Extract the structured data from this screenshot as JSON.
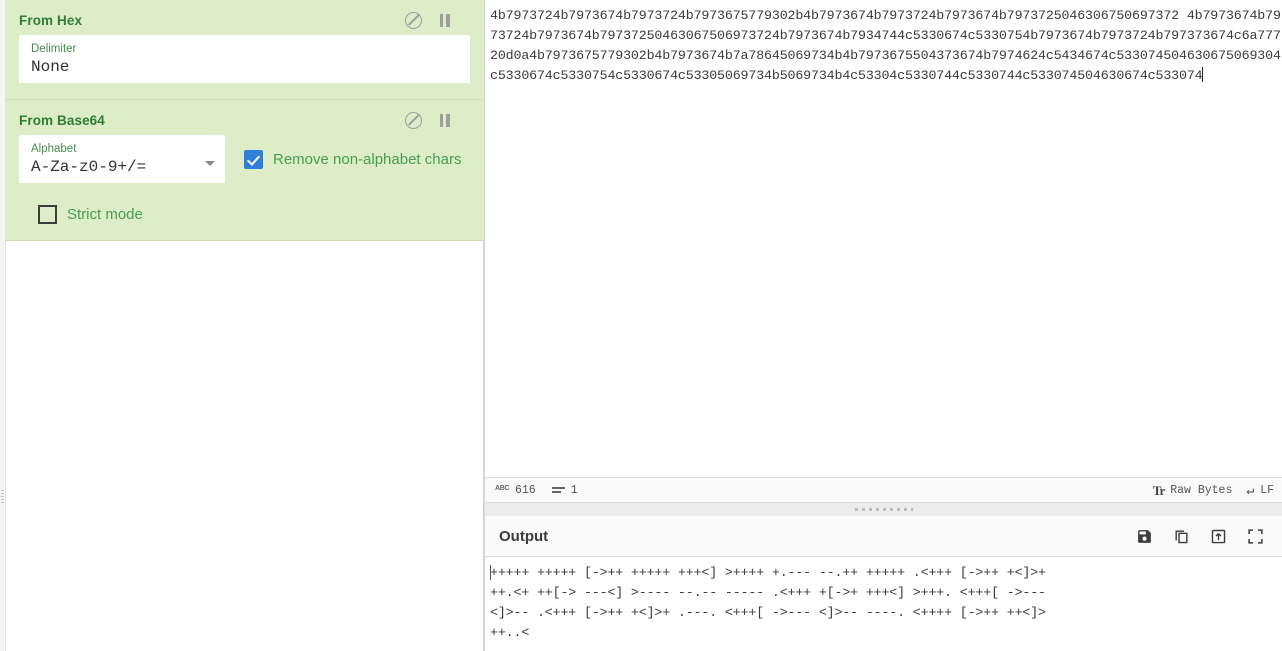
{
  "recipe": {
    "operations": [
      {
        "name": "From Hex",
        "disable_icon": "disable-circle-slash-icon",
        "pause_icon": "pause-breakpoint-icon",
        "args": [
          {
            "type": "text",
            "label": "Delimiter",
            "value": "None"
          }
        ]
      },
      {
        "name": "From Base64",
        "disable_icon": "disable-circle-slash-icon",
        "pause_icon": "pause-breakpoint-icon",
        "args": [
          {
            "type": "select",
            "label": "Alphabet",
            "value": "A-Za-z0-9+/="
          },
          {
            "type": "checkbox",
            "label": "Remove non-alphabet chars",
            "checked": true
          },
          {
            "type": "checkbox",
            "label": "Strict mode",
            "checked": false
          }
        ]
      }
    ]
  },
  "input": {
    "value": "4b7973724b7973674b7973724b7973675779302b4b7973674b7973724b7973674b7973725046306750697372 4b7973674b7973724b7973674b79737250463067506973724b7973674b7934744c5330674c5330754b7973674b7973724b797373674c6a77720d0a4b7973675779302b4b7973674b7a78645069734b4b7973675504373674b7974624c5434674c533074504630675069304c5330674c5330754c5330674c53305069734b5069734b4c53304c5330744c5330744c533074504630674c533074",
    "char_count": "616",
    "line_count": "1",
    "encoding_label": "Raw Bytes",
    "line_ending_label": "LF",
    "char_count_icon": "abc-character-count-icon",
    "line_count_icon": "lines-count-icon",
    "encoding_icon": "font-tt-icon",
    "line_ending_icon": "return-arrow-icon"
  },
  "output": {
    "title": "Output",
    "value": "+++++ +++++ [->++ +++++ +++<] >++++ +.--- --.++ +++++ .<+++ [->++ +<]>+\n++.<+ ++[-> ---<] >---- --.-- ----- .<+++ +[->+ +++<] >+++. <+++[ ->---\n<]>-- .<+++ [->++ +<]>+ .---. <+++[ ->--- <]>-- ----. <++++ [->++ ++<]>\n++..<",
    "icons": [
      {
        "name": "save-icon",
        "title": "Save output to file"
      },
      {
        "name": "copy-icon",
        "title": "Copy raw output to the clipboard"
      },
      {
        "name": "move-output-to-input-icon",
        "title": "Replace input with output"
      },
      {
        "name": "maximise-icon",
        "title": "Maximise output pane"
      }
    ]
  },
  "colors": {
    "operation_bg": "#dcedc8",
    "operation_title": "#2f7d32",
    "field_label": "#4a8c4d",
    "checkbox_accent": "#2f7ed8",
    "checkbox_label": "#4a9c4f",
    "panel_bg": "#fafafa"
  }
}
